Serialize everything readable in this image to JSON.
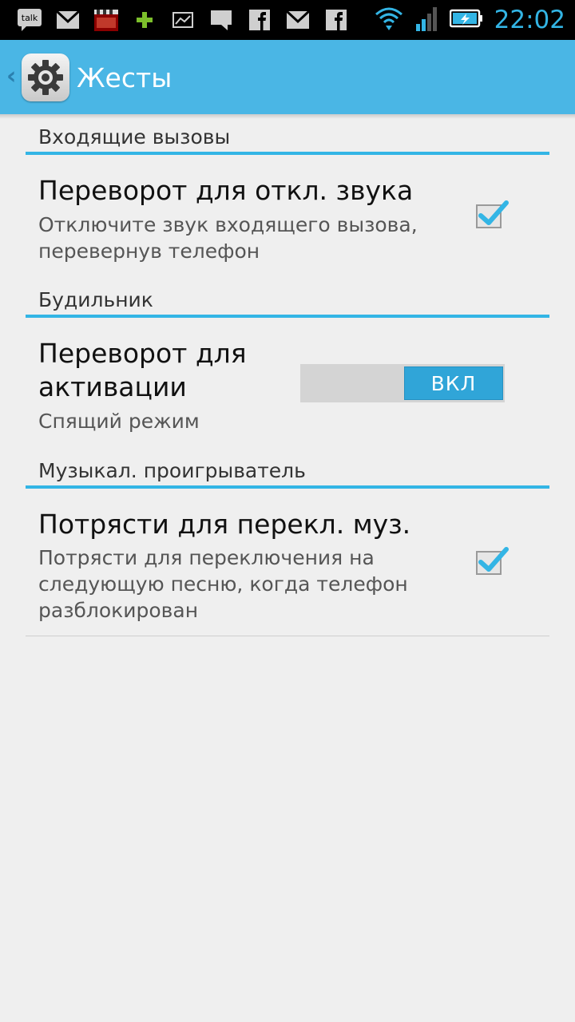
{
  "status_bar": {
    "icons": [
      "talk-icon",
      "gmail-icon",
      "video-icon",
      "plus-icon",
      "gallery-icon",
      "chat-icon",
      "facebook-icon",
      "gmail-icon",
      "facebook-icon"
    ],
    "talk_label": "talk",
    "time": "22:02"
  },
  "action_bar": {
    "title": "Жесты"
  },
  "sections": {
    "calls": {
      "header": "Входящие вызовы",
      "item_title": "Переворот для откл. звука",
      "item_summary": "Отключите звук входящего вызова, перевернув телефон",
      "checked": true
    },
    "alarm": {
      "header": "Будильник",
      "item_title": "Переворот для активации",
      "item_summary": "Спящий режим",
      "toggle_label": "ВКЛ"
    },
    "music": {
      "header": "Музыкал. проигрыватель",
      "item_title": "Потрясти для перекл. муз.",
      "item_summary": "Потрясти для переключения на следующую песню, когда телефон разблокирован",
      "checked": true
    }
  },
  "colors": {
    "accent": "#33b5e5",
    "action_bar": "#4ab6e5",
    "toggle_on": "#30a5d8"
  }
}
